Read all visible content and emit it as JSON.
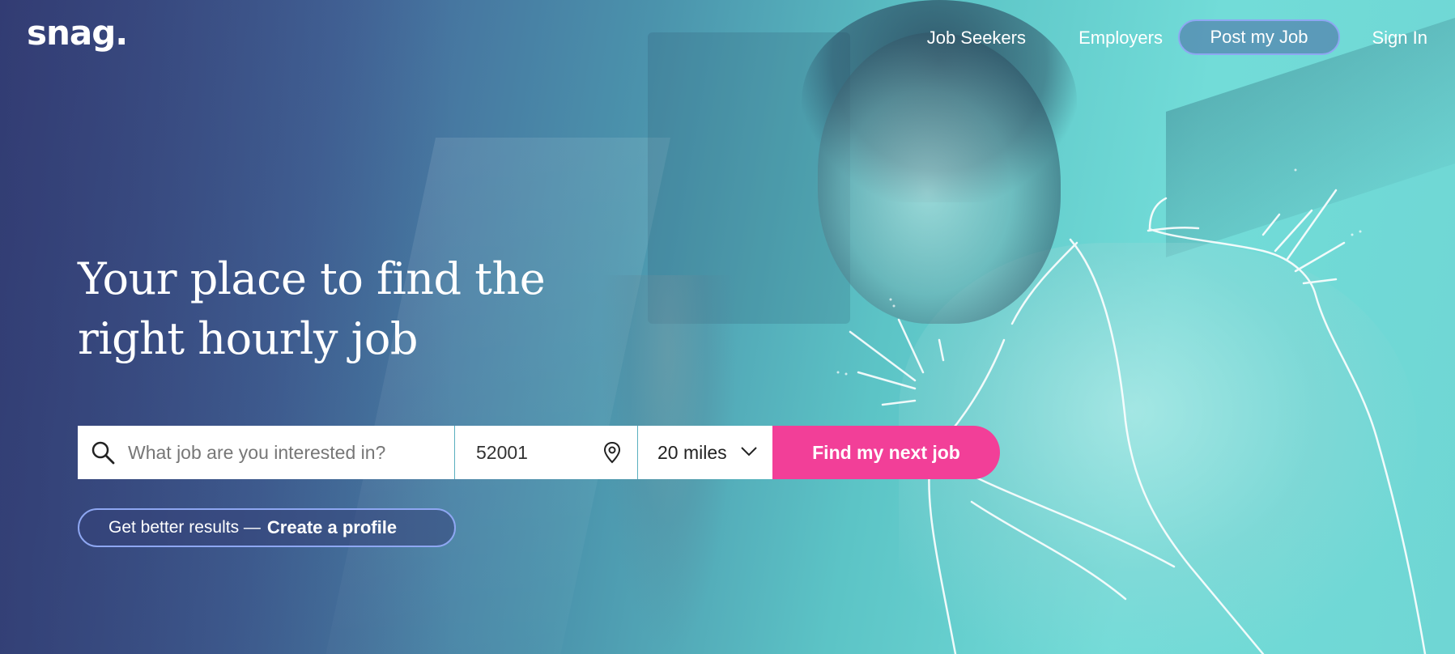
{
  "brand": {
    "logo": "snag."
  },
  "nav": {
    "job_seekers": "Job Seekers",
    "employers": "Employers",
    "post_job": "Post my Job",
    "sign_in": "Sign In"
  },
  "hero": {
    "headline_line1": "Your place to find the",
    "headline_line2": "right hourly job"
  },
  "search": {
    "job_placeholder": "What job are you interested in?",
    "zip_value": "52001",
    "radius_value": "20 miles",
    "submit_label": "Find my next job"
  },
  "profile_prompt": {
    "lead": "Get better results —",
    "cta": "Create a profile"
  },
  "icons": {
    "search": "search-icon",
    "location": "location-pin-icon",
    "dropdown": "chevron-down-icon"
  },
  "colors": {
    "accent_pink": "#f23f98",
    "pill_border": "#8ea7f2",
    "gradient_left": "#3f4b86",
    "gradient_right": "#6fd6d4"
  }
}
